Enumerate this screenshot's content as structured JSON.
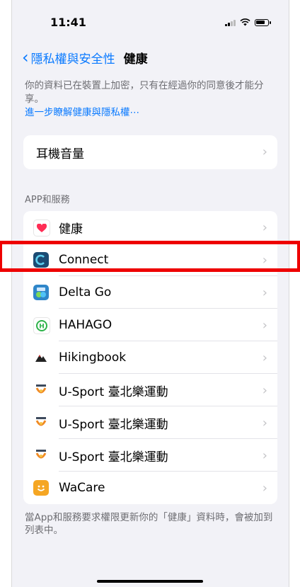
{
  "status_bar": {
    "time": "11:41"
  },
  "nav": {
    "back_label": "隱私權與安全性",
    "title": "健康"
  },
  "description": {
    "text": "你的資料已在裝置上加密，只有在經過你的同意後才能分享。",
    "link": "進一步瞭解健康與隱私權⋯"
  },
  "settings_row": {
    "label": "耳機音量"
  },
  "apps_section": {
    "header": "APP和服務",
    "items": [
      {
        "label": "健康",
        "icon": "heart-icon",
        "color": "#ff2d55"
      },
      {
        "label": "Connect",
        "icon": "connect-icon",
        "color": "#1c4b73"
      },
      {
        "label": "Delta Go",
        "icon": "delta-go-icon",
        "color": "#2f86c9"
      },
      {
        "label": "HAHAGO",
        "icon": "hahago-icon",
        "color": "#2eb34a"
      },
      {
        "label": "Hikingbook",
        "icon": "hikingbook-icon",
        "color": "#222222"
      },
      {
        "label": "U-Sport 臺北樂運動",
        "icon": "usport-icon",
        "color": "#f08a24"
      },
      {
        "label": "U-Sport 臺北樂運動",
        "icon": "usport-icon",
        "color": "#f08a24"
      },
      {
        "label": "U-Sport 臺北樂運動",
        "icon": "usport-icon",
        "color": "#f08a24"
      },
      {
        "label": "WaCare",
        "icon": "wacare-icon",
        "color": "#f5a623"
      }
    ]
  },
  "footer": {
    "text": "當App和服務要求權限更新你的「健康」資料時，會被加到列表中。"
  },
  "highlight_target": "Connect"
}
